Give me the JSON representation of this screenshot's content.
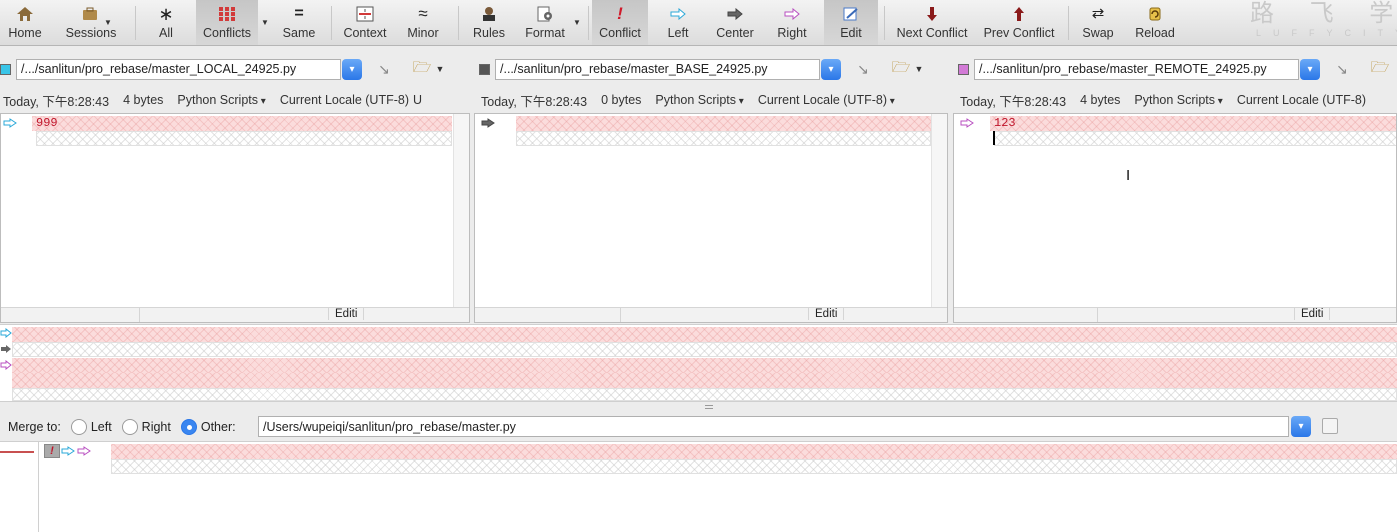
{
  "toolbar": {
    "home": "Home",
    "sessions": "Sessions",
    "all": "All",
    "conflicts": "Conflicts",
    "same": "Same",
    "context": "Context",
    "minor": "Minor",
    "rules": "Rules",
    "format": "Format",
    "conflict": "Conflict",
    "left": "Left",
    "center": "Center",
    "right": "Right",
    "edit": "Edit",
    "next_conflict": "Next Conflict",
    "prev_conflict": "Prev Conflict",
    "swap": "Swap",
    "reload": "Reload"
  },
  "watermark": {
    "line1": "路 飞 学 城",
    "line2": "LUFFYCITY"
  },
  "panes": [
    {
      "path": "/.../sanlitun/pro_rebase/master_LOCAL_24925.py",
      "swatch": "#39c5e8",
      "date": "Today, 下午8:28:43",
      "size": "4 bytes",
      "format": "Python Scripts",
      "encoding": "Current Locale (UTF-8)",
      "extra": "U",
      "line1": "999",
      "status": "Editi"
    },
    {
      "path": "/.../sanlitun/pro_rebase/master_BASE_24925.py",
      "swatch": "#555555",
      "date": "Today, 下午8:28:43",
      "size": "0 bytes",
      "format": "Python Scripts",
      "encoding": "Current Locale (UTF-8)",
      "extra": "",
      "line1": "",
      "status": "Editi"
    },
    {
      "path": "/.../sanlitun/pro_rebase/master_REMOTE_24925.py",
      "swatch": "#d27ad6",
      "date": "Today, 下午8:28:43",
      "size": "4 bytes",
      "format": "Python Scripts",
      "encoding": "Current Locale (UTF-8)",
      "extra": "",
      "line1": "123",
      "status": "Editi"
    }
  ],
  "merge": {
    "label": "Merge to:",
    "left": "Left",
    "right": "Right",
    "other": "Other:",
    "selected": "Other",
    "output_path": "/Users/wupeiqi/sanlitun/pro_rebase/master.py"
  },
  "colors": {
    "accent": "#2a77e8",
    "conflict_red": "#c0142a",
    "diff_pink": "#fbdcdc"
  }
}
